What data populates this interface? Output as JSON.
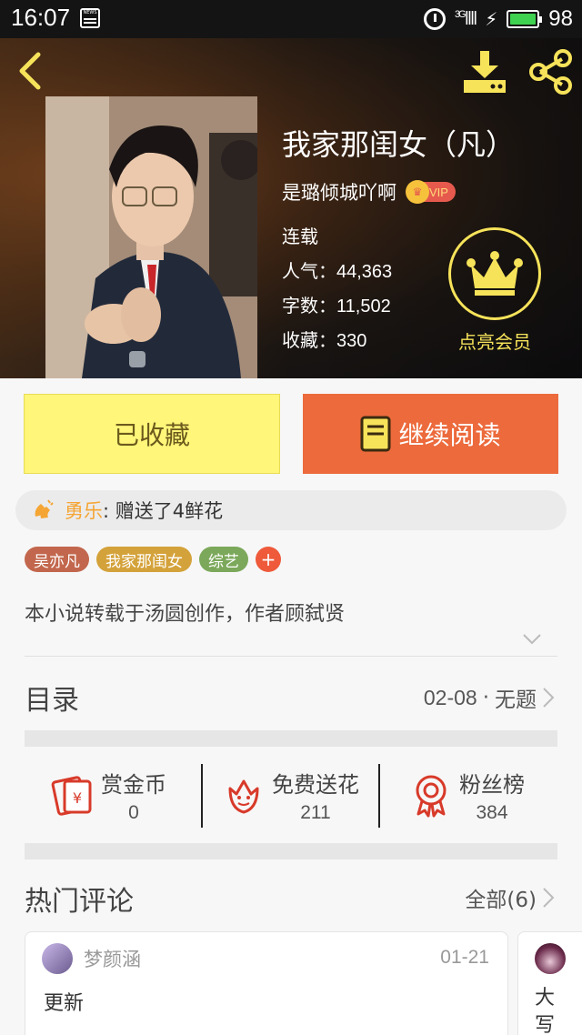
{
  "status_bar": {
    "time": "16:07",
    "news_label": "NEWS",
    "signal": "3G",
    "battery_pct": "98",
    "battery_level": 0.98
  },
  "colors": {
    "accent_orange": "#ec6a3c",
    "fav_yellow": "#fff67a",
    "member_gold": "#f7e35a",
    "gift_user": "#f5a533"
  },
  "header": {
    "icons": {
      "back": "back-icon",
      "download": "download-icon",
      "share": "share-icon"
    },
    "book_title": "我家那闺女（凡）",
    "author": "是璐倾城吖啊",
    "vip_label": "VIP",
    "status": "连载",
    "stats": [
      {
        "key": "人气：",
        "value": "44,363"
      },
      {
        "key": "字数：",
        "value": "11,502"
      },
      {
        "key": "收藏：",
        "value": "330"
      }
    ],
    "member_label": "点亮会员"
  },
  "actions": {
    "favorited_label": "已收藏",
    "continue_label": "继续阅读"
  },
  "gift": {
    "user": "勇乐",
    "text": ": 赠送了4鲜花"
  },
  "tags": [
    {
      "label": "吴亦凡",
      "color": "#c2674d"
    },
    {
      "label": "我家那闺女",
      "color": "#d4a23a"
    },
    {
      "label": "综艺",
      "color": "#7ba85a"
    }
  ],
  "tag_add_label": "+",
  "description": "本小说转载于汤圆创作，作者顾弑贤",
  "toc": {
    "title": "目录",
    "latest_date": "02-08",
    "latest_sep": "·",
    "latest_title": "无题"
  },
  "stats_row": [
    {
      "label": "赏金币",
      "value": "0",
      "icon": "red-envelope-icon"
    },
    {
      "label": "免费送花",
      "value": "211",
      "icon": "flower-icon"
    },
    {
      "label": "粉丝榜",
      "value": "384",
      "icon": "rank-badge-icon"
    }
  ],
  "hot_comments": {
    "title": "热门评论",
    "all_label": "全部(6)",
    "comments": [
      {
        "name": "梦颜涵",
        "date": "01-21",
        "text": "更新"
      },
      {
        "name": "",
        "date": "",
        "text": "大写"
      }
    ]
  }
}
